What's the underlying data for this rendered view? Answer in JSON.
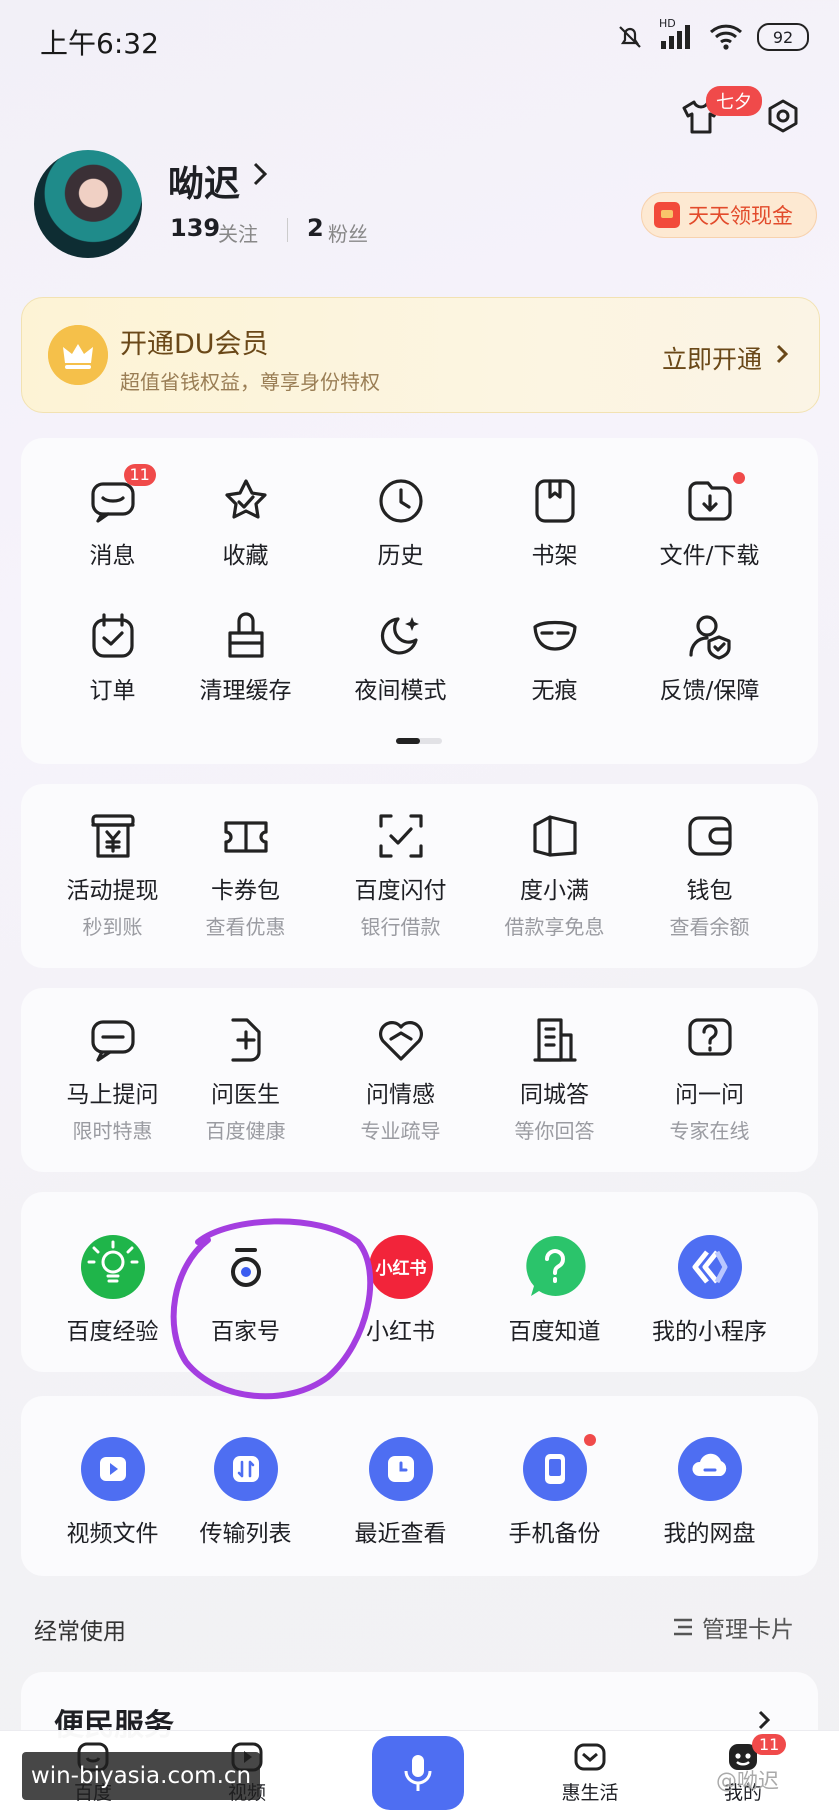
{
  "status_bar": {
    "time": "上午6:32",
    "signal_label": "HD",
    "battery": "92"
  },
  "header": {
    "skin_badge": "七夕"
  },
  "profile": {
    "username": "呦迟",
    "follow_count": "139",
    "follow_label": "关注",
    "fans_count": "2",
    "fans_label": "粉丝",
    "cash_button": "天天领现金"
  },
  "vip": {
    "title": "开通DU会员",
    "subtitle": "超值省钱权益，尊享身份特权",
    "cta": "立即开通"
  },
  "tools": [
    {
      "label": "消息",
      "icon": "message-icon",
      "badge": "11"
    },
    {
      "label": "收藏",
      "icon": "star-icon"
    },
    {
      "label": "历史",
      "icon": "clock-icon"
    },
    {
      "label": "书架",
      "icon": "bookshelf-icon"
    },
    {
      "label": "文件/下载",
      "icon": "download-icon",
      "dot": true
    },
    {
      "label": "订单",
      "icon": "order-icon"
    },
    {
      "label": "清理缓存",
      "icon": "clean-icon"
    },
    {
      "label": "夜间模式",
      "icon": "moon-icon"
    },
    {
      "label": "无痕",
      "icon": "mask-icon"
    },
    {
      "label": "反馈/保障",
      "icon": "feedback-icon"
    }
  ],
  "finance": [
    {
      "label": "活动提现",
      "sub": "秒到账",
      "icon": "withdraw-icon"
    },
    {
      "label": "卡券包",
      "sub": "查看优惠",
      "icon": "coupon-icon"
    },
    {
      "label": "百度闪付",
      "sub": "银行借款",
      "icon": "flash-pay-icon"
    },
    {
      "label": "度小满",
      "sub": "借款享免息",
      "icon": "duxiaoman-icon"
    },
    {
      "label": "钱包",
      "sub": "查看余额",
      "icon": "wallet-icon"
    }
  ],
  "consult": [
    {
      "label": "马上提问",
      "sub": "限时特惠",
      "icon": "ask-icon"
    },
    {
      "label": "问医生",
      "sub": "百度健康",
      "icon": "doctor-icon"
    },
    {
      "label": "问情感",
      "sub": "专业疏导",
      "icon": "heart-icon"
    },
    {
      "label": "同城答",
      "sub": "等你回答",
      "icon": "building-icon"
    },
    {
      "label": "问一问",
      "sub": "专家在线",
      "icon": "question-icon"
    }
  ],
  "apps": [
    {
      "label": "百度经验",
      "icon": "jingyan-icon",
      "color": "#1fb54a"
    },
    {
      "label": "百家号",
      "icon": "baijiahao-icon",
      "color": "#ffffff"
    },
    {
      "label": "小红书",
      "icon": "xiaohongshu-icon",
      "color": "#f2243a",
      "text": "小红书"
    },
    {
      "label": "百度知道",
      "icon": "zhidao-icon",
      "color": "#2bc46b"
    },
    {
      "label": "我的小程序",
      "icon": "miniprogram-icon",
      "color": "#4e6ef2"
    }
  ],
  "netdisk": [
    {
      "label": "视频文件",
      "icon": "video-file-icon"
    },
    {
      "label": "传输列表",
      "icon": "transfer-icon"
    },
    {
      "label": "最近查看",
      "icon": "recent-icon"
    },
    {
      "label": "手机备份",
      "icon": "backup-icon",
      "dot": true
    },
    {
      "label": "我的网盘",
      "icon": "cloud-icon"
    }
  ],
  "frequent": {
    "title": "经常使用",
    "manage": "管理卡片"
  },
  "convenience": {
    "title": "便民服务"
  },
  "bottom_nav": [
    {
      "label": "百度",
      "icon": "home-icon"
    },
    {
      "label": "视频",
      "icon": "video-icon"
    },
    {
      "label": "",
      "icon": "mic-icon"
    },
    {
      "label": "惠生活",
      "icon": "life-icon"
    },
    {
      "label": "我的",
      "icon": "mine-icon",
      "badge": "11"
    }
  ],
  "watermark": {
    "text": "win-biyasia.com.cn",
    "author": "@呦迟"
  },
  "colors": {
    "accent": "#4e6ef2",
    "badge": "#f04a4a",
    "annotation": "#a43ee0"
  }
}
